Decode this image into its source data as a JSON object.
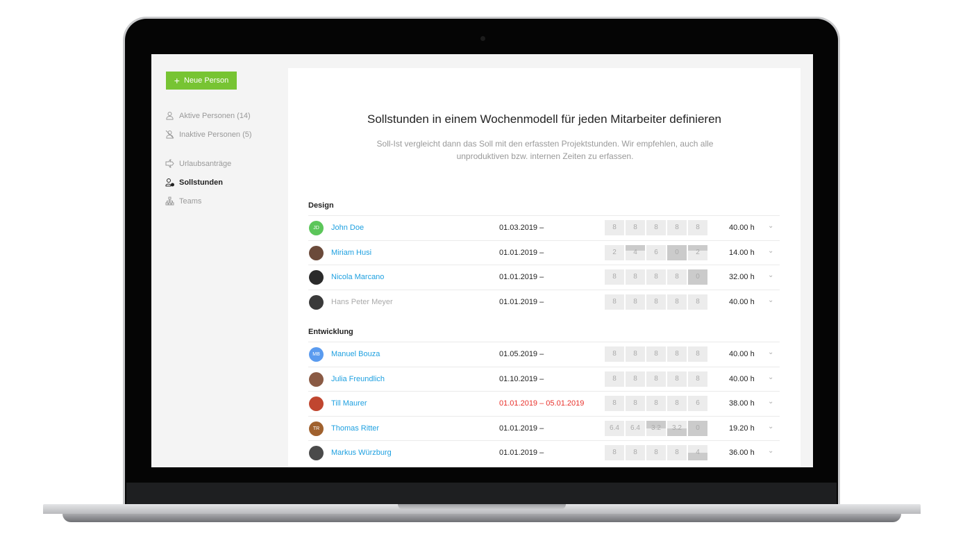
{
  "sidebar": {
    "new_button": "Neue Person",
    "items": [
      {
        "label": "Aktive Personen (14)",
        "icon": "person-icon",
        "active": false
      },
      {
        "label": "Inaktive Personen (5)",
        "icon": "person-off-icon",
        "active": false
      },
      {
        "label": "Urlaubsanträge",
        "icon": "plane-icon",
        "active": false
      },
      {
        "label": "Sollstunden",
        "icon": "person-clock-icon",
        "active": true
      },
      {
        "label": "Teams",
        "icon": "org-chart-icon",
        "active": false
      }
    ]
  },
  "main": {
    "title": "Sollstunden in einem Wochenmodell für jeden Mitarbeiter definieren",
    "subtitle": "Soll-Ist vergleicht dann das Soll mit den erfassten Projektstunden. Wir empfehlen, auch alle unproduktiven bzw. internen Zeiten zu erfassen.",
    "groups": [
      {
        "name": "Design",
        "rows": [
          {
            "name": "John Doe",
            "initials": "JD",
            "avatar_color": "#5cc65a",
            "date": "01.03.2019 –",
            "days": [
              {
                "v": "8"
              },
              {
                "v": "8"
              },
              {
                "v": "8"
              },
              {
                "v": "8"
              },
              {
                "v": "8"
              }
            ],
            "total": "40.00 h"
          },
          {
            "name": "Miriam Husi",
            "avatar_color": "#6b4a3a",
            "date": "01.01.2019 –",
            "days": [
              {
                "v": "2"
              },
              {
                "v": "4",
                "fill": 0.4,
                "pos": "top"
              },
              {
                "v": "6"
              },
              {
                "v": "0",
                "fill": 1,
                "pos": "top"
              },
              {
                "v": "2",
                "fill": 0.4,
                "pos": "top"
              }
            ],
            "total": "14.00 h"
          },
          {
            "name": "Nicola Marcano",
            "avatar_color": "#2b2b2b",
            "date": "01.01.2019 –",
            "days": [
              {
                "v": "8"
              },
              {
                "v": "8"
              },
              {
                "v": "8"
              },
              {
                "v": "8"
              },
              {
                "v": "0",
                "fill": 1,
                "pos": "top"
              }
            ],
            "total": "32.00 h"
          },
          {
            "name": "Hans Peter Meyer",
            "avatar_color": "#3a3a3a",
            "inactive": true,
            "date": "01.01.2019 –",
            "days": [
              {
                "v": "8"
              },
              {
                "v": "8"
              },
              {
                "v": "8"
              },
              {
                "v": "8"
              },
              {
                "v": "8"
              }
            ],
            "total": "40.00 h"
          }
        ]
      },
      {
        "name": "Entwicklung",
        "rows": [
          {
            "name": "Manuel Bouza",
            "initials": "MB",
            "avatar_color": "#5a9bef",
            "date": "01.05.2019 –",
            "days": [
              {
                "v": "8"
              },
              {
                "v": "8"
              },
              {
                "v": "8"
              },
              {
                "v": "8"
              },
              {
                "v": "8"
              }
            ],
            "total": "40.00 h"
          },
          {
            "name": "Julia Freundlich",
            "avatar_color": "#8a5a44",
            "date": "01.10.2019 –",
            "days": [
              {
                "v": "8"
              },
              {
                "v": "8"
              },
              {
                "v": "8"
              },
              {
                "v": "8"
              },
              {
                "v": "8"
              }
            ],
            "total": "40.00 h"
          },
          {
            "name": "Till Maurer",
            "avatar_color": "#c0462f",
            "date": "01.01.2019 – 05.01.2019",
            "date_red": true,
            "days": [
              {
                "v": "8"
              },
              {
                "v": "8"
              },
              {
                "v": "8"
              },
              {
                "v": "8"
              },
              {
                "v": "6"
              }
            ],
            "total": "38.00 h"
          },
          {
            "name": "Thomas Ritter",
            "initials": "TR",
            "avatar_color": "#a0612e",
            "date": "01.01.2019 –",
            "days": [
              {
                "v": "6.4"
              },
              {
                "v": "6.4"
              },
              {
                "v": "3.2",
                "fill": 0.5,
                "pos": "top"
              },
              {
                "v": "3.2",
                "fill": 0.5,
                "pos": "bottom"
              },
              {
                "v": "0",
                "fill": 1,
                "pos": "top"
              }
            ],
            "total": "19.20 h"
          },
          {
            "name": "Markus Würzburg",
            "avatar_color": "#4a4a4a",
            "date": "01.01.2019 –",
            "days": [
              {
                "v": "8"
              },
              {
                "v": "8"
              },
              {
                "v": "8"
              },
              {
                "v": "8"
              },
              {
                "v": "4",
                "fill": 0.5,
                "pos": "bottom"
              }
            ],
            "total": "36.00 h"
          }
        ]
      }
    ]
  }
}
